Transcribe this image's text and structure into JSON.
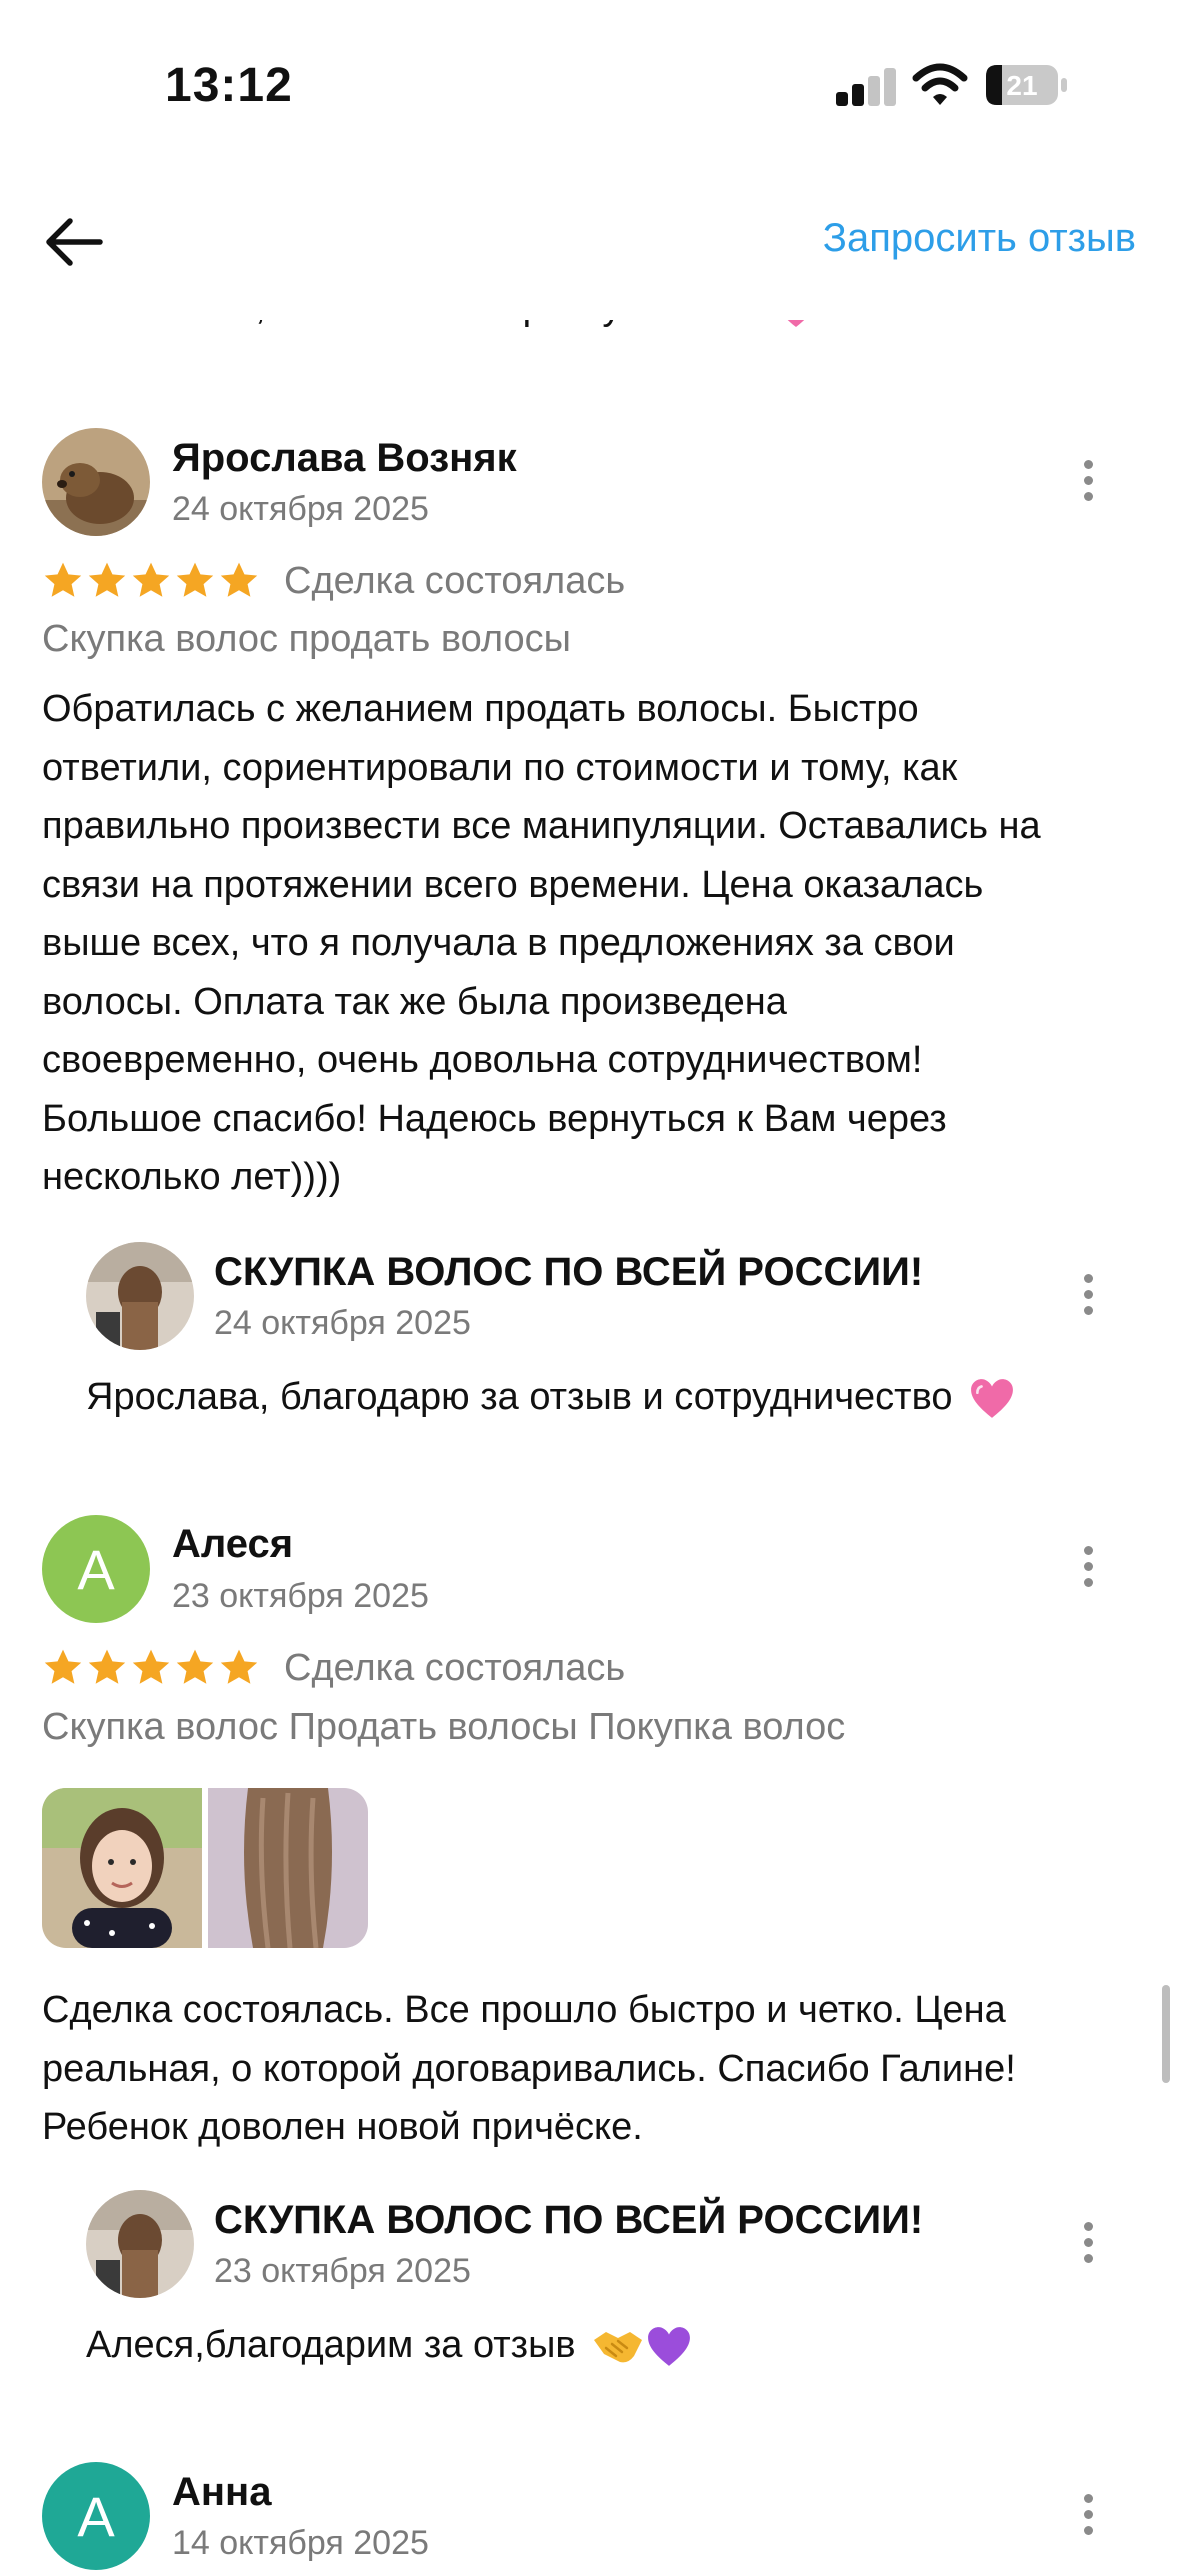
{
  "status_bar": {
    "time": "13:12",
    "battery": "21"
  },
  "header": {
    "request_review": "Запросить отзыв"
  },
  "cutoff_reply": "Светлана, спасибо за обратную связь",
  "reviews": [
    {
      "author": "Ярослава Возняк",
      "date": "24 октября 2025",
      "rating": 5,
      "deal": "Сделка состоялась",
      "tags": "Скупка волос продать волосы",
      "lines": [
        "Обратилась с желанием продать волосы. Быстро",
        "ответили, сориентировали по стоимости и тому, как",
        "правильно произвести все манипуляции. Оставались на",
        "связи на протяжении всего времени. Цена оказалась",
        "выше всех, что я получала в предложениях за свои",
        "волосы. Оплата так же была произведена",
        "своевременно, очень довольна сотрудничеством!",
        "Большое спасибо! Надеюсь вернуться к Вам через",
        "несколько лет))))"
      ],
      "reply": {
        "author": "СКУПКА ВОЛОС ПО ВСЕЙ РОССИИ!",
        "date": "24 октября 2025",
        "text": "Ярослава, благодарю за отзыв и сотрудничество"
      }
    },
    {
      "author": "Алеся",
      "avatar_letter": "А",
      "avatar_color": "#8dc653",
      "date": "23 октября 2025",
      "rating": 5,
      "deal": "Сделка состоялась",
      "tags": "Скупка волос Продать волосы Покупка волос",
      "lines": [
        "Сделка состоялась. Все прошло быстро и четко. Цена",
        "реальная, о которой договаривались. Спасибо Галине!",
        "Ребенок доволен новой причёске."
      ],
      "reply": {
        "author": "СКУПКА ВОЛОС ПО ВСЕЙ РОССИИ!",
        "date": "23 октября 2025",
        "text": "Алеся,благодарим за отзыв"
      }
    },
    {
      "author": "Анна",
      "avatar_letter": "А",
      "avatar_color": "#1fa896",
      "date": "14 октября 2025"
    }
  ],
  "colors": {
    "accent": "#2d9ee8",
    "star": "#f5a623",
    "muted": "#7a7a7a"
  },
  "icons": [
    "back-arrow-icon",
    "more-vertical-icon",
    "star-icon",
    "heart-emoji-icon",
    "handshake-emoji-icon",
    "purple-heart-emoji-icon"
  ]
}
